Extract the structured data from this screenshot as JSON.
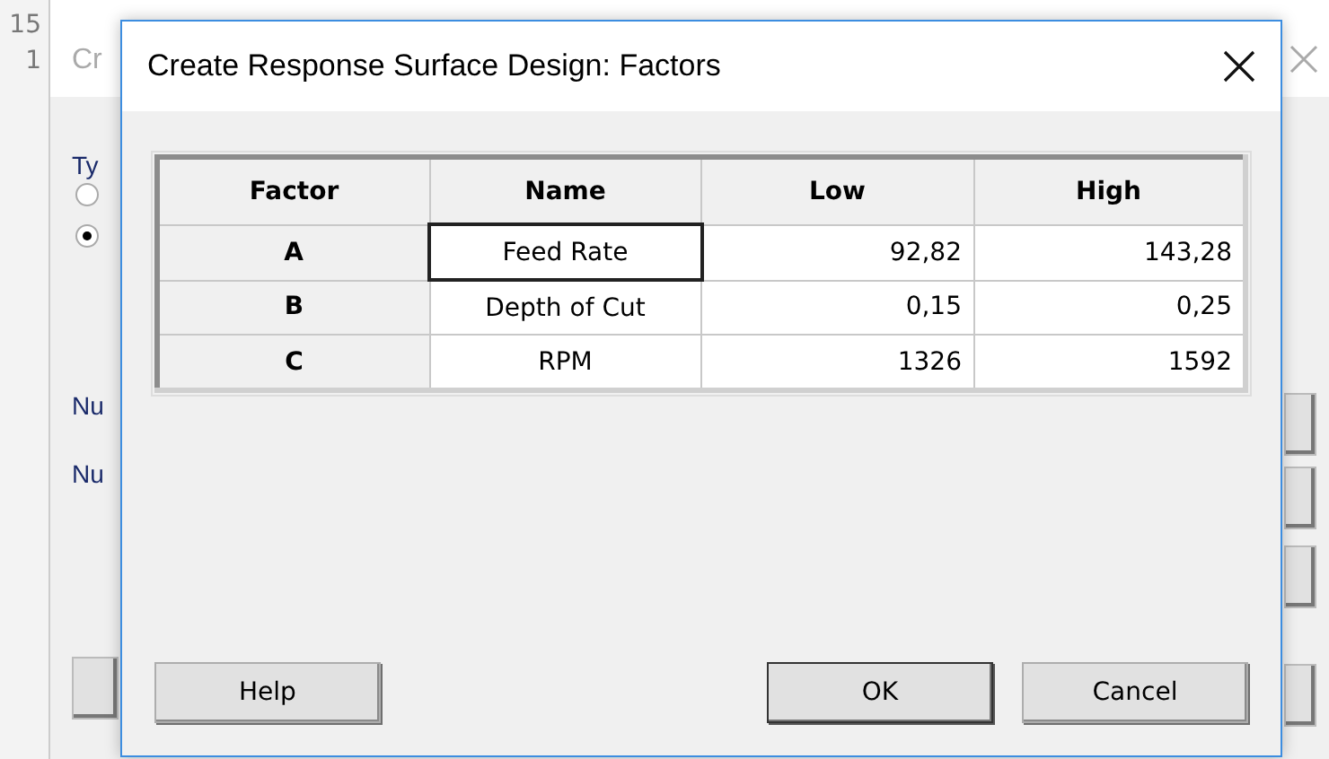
{
  "background_sheet": {
    "row_numbers": [
      "15",
      "1"
    ]
  },
  "background_dialog": {
    "title": "Cr",
    "type_label": "Ty",
    "radios": [
      {
        "selected": false
      },
      {
        "selected": true
      }
    ],
    "labels": [
      "Nu",
      "Nu"
    ]
  },
  "dialog": {
    "title": "Create Response Surface Design: Factors",
    "table": {
      "columns": [
        "Factor",
        "Name",
        "Low",
        "High"
      ],
      "rows": [
        {
          "factor": "A",
          "name": "Feed Rate",
          "low": "92,82",
          "high": "143,28",
          "focused": true
        },
        {
          "factor": "B",
          "name": "Depth of Cut",
          "low": "0,15",
          "high": "0,25",
          "focused": false
        },
        {
          "factor": "C",
          "name": "RPM",
          "low": "1326",
          "high": "1592",
          "focused": false
        }
      ]
    },
    "buttons": [
      {
        "label": "Help",
        "default": false
      },
      {
        "label": "OK",
        "default": true
      },
      {
        "label": "Cancel",
        "default": false
      }
    ]
  }
}
